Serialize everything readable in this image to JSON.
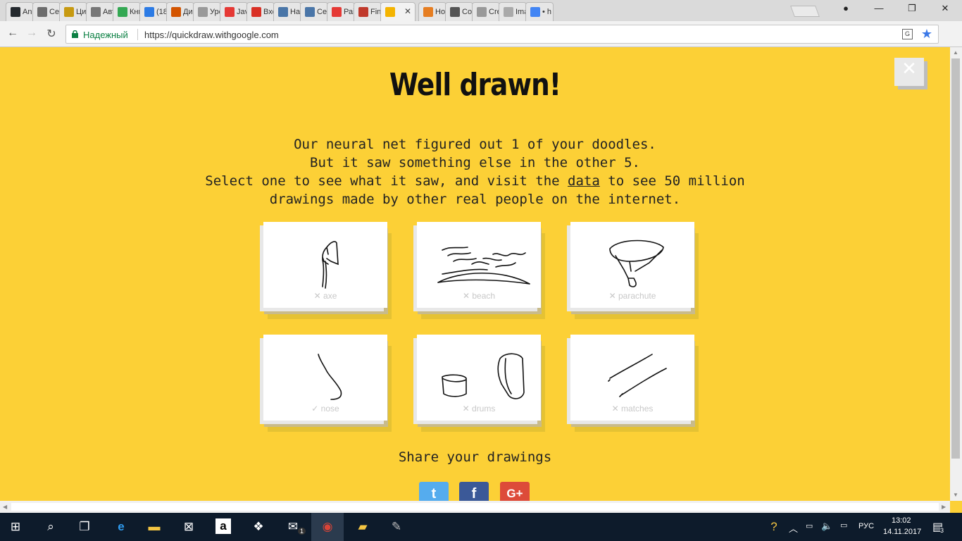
{
  "browser": {
    "tabs": [
      {
        "label": "Anc",
        "icon": "github-icon",
        "color": "#24292e"
      },
      {
        "label": "Сеі",
        "icon": "book-icon",
        "color": "#6d6d6d"
      },
      {
        "label": "Ци",
        "icon": "coin-icon",
        "color": "#c79a11"
      },
      {
        "label": "Авт",
        "icon": "wikipedia-icon",
        "color": "#777"
      },
      {
        "label": "Кни",
        "icon": "drive-icon",
        "color": "#34a853"
      },
      {
        "label": "(18",
        "icon": "ring-icon",
        "color": "#2c7be5"
      },
      {
        "label": "Ди",
        "icon": "chinese-icon",
        "color": "#d35400"
      },
      {
        "label": "Урс",
        "icon": "page-icon",
        "color": "#999"
      },
      {
        "label": "Jav",
        "icon": "coursera-icon",
        "color": "#e53935"
      },
      {
        "label": "Вхс",
        "icon": "gmail-icon",
        "color": "#d93025"
      },
      {
        "label": "Наі",
        "icon": "vk-icon",
        "color": "#4a76a8"
      },
      {
        "label": "Сеі",
        "icon": "vk-icon",
        "color": "#4a76a8"
      },
      {
        "label": "Раі",
        "icon": "yandex-icon",
        "color": "#e53935"
      },
      {
        "label": "Fin",
        "icon": "shield-icon",
        "color": "#c0392b"
      },
      {
        "label": "",
        "icon": "quickdraw-icon",
        "color": "#f4b400",
        "active": true
      },
      {
        "label": "Ho",
        "icon": "face-icon",
        "color": "#e67e22"
      },
      {
        "label": "Co",
        "icon": "tent-icon",
        "color": "#555"
      },
      {
        "label": "Cre",
        "icon": "page-icon",
        "color": "#999"
      },
      {
        "label": "Ima",
        "icon": "gear-icon",
        "color": "#aaa"
      },
      {
        "label": "• h",
        "icon": "google-icon",
        "color": "#4285f4"
      }
    ],
    "security_label": "Надежный",
    "url": "https://quickdraw.withgoogle.com"
  },
  "page": {
    "title": "Well drawn!",
    "desc_line1": "Our neural net figured out 1 of your doodles.",
    "desc_line2": "But it saw something else in the other 5.",
    "desc_line3_pre": "Select one to see what it saw, and visit the ",
    "desc_link": "data",
    "desc_line3_post": " to see 50 million",
    "desc_line4": "drawings made by other real people on the internet.",
    "close_symbol": "✕",
    "share_label": "Share your drawings",
    "cards": [
      {
        "label": "✕ axe",
        "word": "axe",
        "recognized": false
      },
      {
        "label": "✕ beach",
        "word": "beach",
        "recognized": false
      },
      {
        "label": "✕ parachute",
        "word": "parachute",
        "recognized": false
      },
      {
        "label": "✓ nose",
        "word": "nose",
        "recognized": true
      },
      {
        "label": "✕ drums",
        "word": "drums",
        "recognized": false
      },
      {
        "label": "✕ matches",
        "word": "matches",
        "recognized": false
      }
    ],
    "social": [
      {
        "name": "twitter",
        "symbol": "t",
        "color": "#55acee"
      },
      {
        "name": "facebook",
        "symbol": "f",
        "color": "#3b5998"
      },
      {
        "name": "google-plus",
        "symbol": "G+",
        "color": "#dd4b39"
      }
    ]
  },
  "taskbar": {
    "language": "РУС",
    "time": "13:02",
    "date": "14.11.2017",
    "notifications": "3",
    "mail_badge": "1"
  }
}
